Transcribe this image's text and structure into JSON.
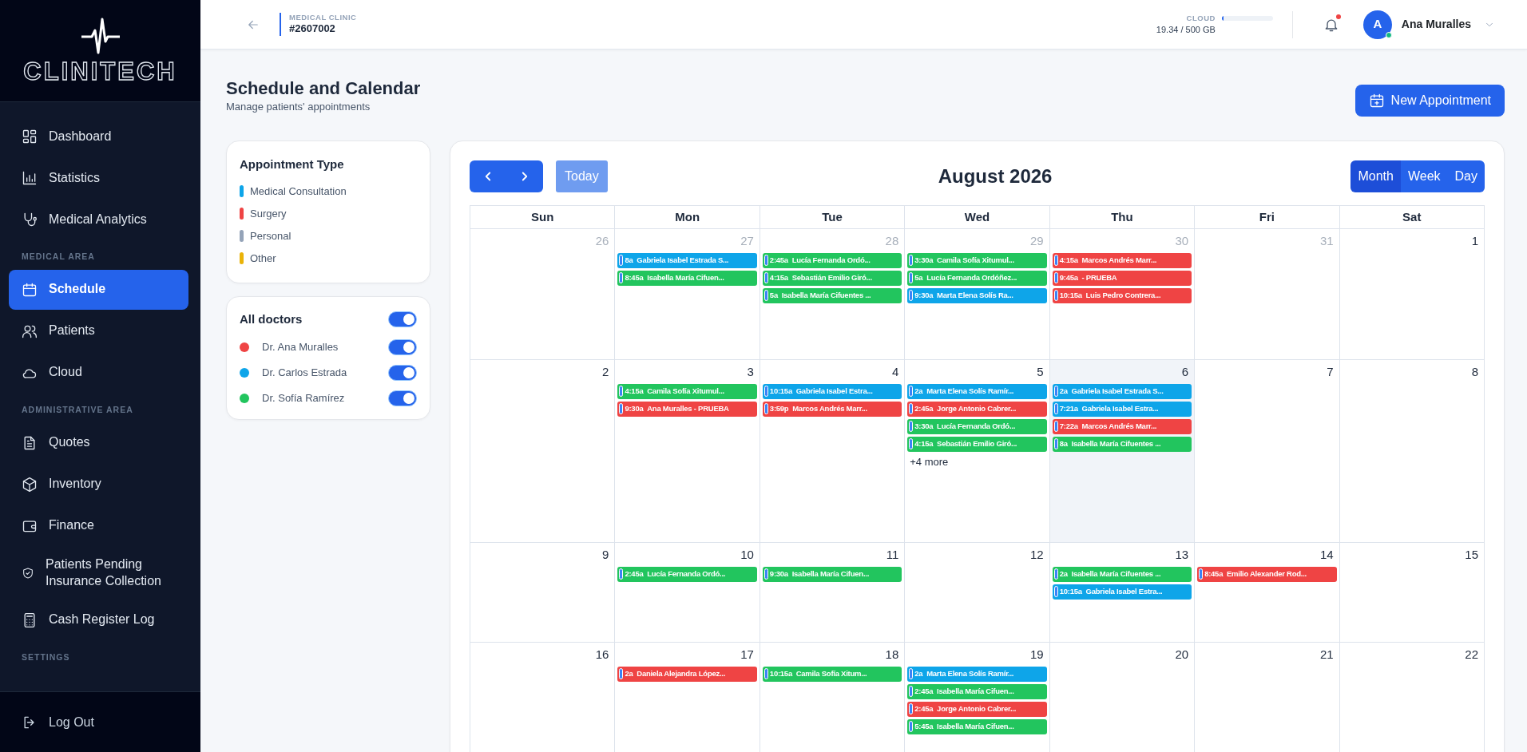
{
  "sidebar": {
    "logo": "CLINITECH",
    "items": [
      {
        "kind": "link",
        "label": "Dashboard",
        "selected": false
      },
      {
        "kind": "link",
        "label": "Statistics",
        "selected": false
      },
      {
        "kind": "link",
        "label": "Medical Analytics",
        "selected": false
      },
      {
        "kind": "section",
        "label": "MEDICAL AREA"
      },
      {
        "kind": "link",
        "label": "Schedule",
        "selected": true
      },
      {
        "kind": "link",
        "label": "Patients",
        "selected": false
      },
      {
        "kind": "link",
        "label": "Cloud",
        "selected": false
      },
      {
        "kind": "section",
        "label": "ADMINISTRATIVE AREA"
      },
      {
        "kind": "link",
        "label": "Quotes",
        "selected": false
      },
      {
        "kind": "link",
        "label": "Inventory",
        "selected": false
      },
      {
        "kind": "link",
        "label": "Finance",
        "selected": false
      },
      {
        "kind": "link",
        "label": "Patients Pending Insurance Collection",
        "selected": false
      },
      {
        "kind": "link",
        "label": "Cash Register Log",
        "selected": false
      },
      {
        "kind": "section",
        "label": "SETTINGS"
      }
    ],
    "logout": "Log Out"
  },
  "topbar": {
    "clinic_label": "MEDICAL CLINIC",
    "clinic_id": "#2607002",
    "cloud": {
      "label": "CLOUD",
      "usage": "19.34 / 500 GB",
      "level": 0.04
    },
    "notification_unread": true,
    "avatar_letter": "A",
    "user_online": true,
    "user_name": "Ana Muralles"
  },
  "page": {
    "title": "Schedule and Calendar",
    "subtitle": "Manage patients' appointments",
    "new_button": "New Appointment"
  },
  "appointment_types": {
    "title": "Appointment Type",
    "items": [
      {
        "label": "Medical Consultation",
        "color": "#0ea5e9"
      },
      {
        "label": "Surgery",
        "color": "#ef4444"
      },
      {
        "label": "Personal",
        "color": "#94a3b8"
      },
      {
        "label": "Other",
        "color": "#eab308"
      }
    ]
  },
  "doctors": {
    "title": "All doctors",
    "all_on": true,
    "items": [
      {
        "name": "Dr. Ana Muralles",
        "color": "#ef4444",
        "on": true
      },
      {
        "name": "Dr. Carlos Estrada",
        "color": "#0ea5e9",
        "on": true
      },
      {
        "name": "Dr. Sofía Ramírez",
        "color": "#22c55e",
        "on": true
      }
    ]
  },
  "calendar": {
    "title": "August 2026",
    "today_button": "Today",
    "views": [
      {
        "label": "Month",
        "selected": true
      },
      {
        "label": "Week",
        "selected": false
      },
      {
        "label": "Day",
        "selected": false
      }
    ],
    "weekdays": [
      "Sun",
      "Mon",
      "Tue",
      "Wed",
      "Thu",
      "Fri",
      "Sat"
    ],
    "weeks": [
      [
        {
          "day": "26",
          "muted": true
        },
        {
          "day": "27",
          "muted": true,
          "events": [
            {
              "time": "8a",
              "title": "Gabriela Isabel Estrada S...",
              "color": "#0ea5e9"
            },
            {
              "time": "8:45a",
              "title": "Isabella María Cifuen...",
              "color": "#22c55e"
            }
          ]
        },
        {
          "day": "28",
          "muted": true,
          "events": [
            {
              "time": "2:45a",
              "title": "Lucía Fernanda Ordó...",
              "color": "#22c55e"
            },
            {
              "time": "4:15a",
              "title": "Sebastián Emilio Giró...",
              "color": "#22c55e"
            },
            {
              "time": "5a",
              "title": "Isabella María Cifuentes ...",
              "color": "#22c55e"
            }
          ]
        },
        {
          "day": "29",
          "muted": true,
          "events": [
            {
              "time": "3:30a",
              "title": "Camila Sofía Xitumul...",
              "color": "#22c55e"
            },
            {
              "time": "5a",
              "title": "Lucía Fernanda Ordóñez...",
              "color": "#22c55e"
            },
            {
              "time": "9:30a",
              "title": "Marta Elena Solís Ra...",
              "color": "#0ea5e9"
            }
          ]
        },
        {
          "day": "30",
          "muted": true,
          "events": [
            {
              "time": "4:15a",
              "title": "Marcos Andrés Marr...",
              "color": "#ef4444"
            },
            {
              "time": "9:45a",
              "title": "- PRUEBA",
              "color": "#ef4444"
            },
            {
              "time": "10:15a",
              "title": "Luis Pedro Contrera...",
              "color": "#ef4444"
            }
          ]
        },
        {
          "day": "31",
          "muted": true
        },
        {
          "day": "1"
        }
      ],
      [
        {
          "day": "2"
        },
        {
          "day": "3",
          "events": [
            {
              "time": "4:15a",
              "title": "Camila Sofía Xitumul...",
              "color": "#22c55e"
            },
            {
              "time": "9:30a",
              "title": "Ana Muralles - PRUEBA",
              "color": "#ef4444"
            }
          ]
        },
        {
          "day": "4",
          "events": [
            {
              "time": "10:15a",
              "title": "Gabriela Isabel Estra...",
              "color": "#0ea5e9"
            },
            {
              "time": "3:59p",
              "title": "Marcos Andrés Marr...",
              "color": "#ef4444"
            }
          ]
        },
        {
          "day": "5",
          "events": [
            {
              "time": "2a",
              "title": "Marta Elena Solís Ramír...",
              "color": "#0ea5e9"
            },
            {
              "time": "2:45a",
              "title": "Jorge Antonio Cabrer...",
              "color": "#ef4444"
            },
            {
              "time": "3:30a",
              "title": "Lucía Fernanda Ordó...",
              "color": "#22c55e"
            },
            {
              "time": "4:15a",
              "title": "Sebastián Emilio Giró...",
              "color": "#22c55e"
            }
          ],
          "more": "+4 more"
        },
        {
          "day": "6",
          "today": true,
          "events": [
            {
              "time": "2a",
              "title": "Gabriela Isabel Estrada S...",
              "color": "#0ea5e9"
            },
            {
              "time": "7:21a",
              "title": "Gabriela Isabel Estra...",
              "color": "#0ea5e9"
            },
            {
              "time": "7:22a",
              "title": "Marcos Andrés Marr...",
              "color": "#ef4444"
            },
            {
              "time": "8a",
              "title": "Isabella María Cifuentes ...",
              "color": "#22c55e"
            }
          ]
        },
        {
          "day": "7"
        },
        {
          "day": "8"
        }
      ],
      [
        {
          "day": "9"
        },
        {
          "day": "10",
          "events": [
            {
              "time": "2:45a",
              "title": "Lucía Fernanda Ordó...",
              "color": "#22c55e"
            }
          ]
        },
        {
          "day": "11",
          "events": [
            {
              "time": "9:30a",
              "title": "Isabella María Cifuen...",
              "color": "#22c55e"
            }
          ]
        },
        {
          "day": "12"
        },
        {
          "day": "13",
          "events": [
            {
              "time": "2a",
              "title": "Isabella María Cifuentes ...",
              "color": "#22c55e"
            },
            {
              "time": "10:15a",
              "title": "Gabriela Isabel Estra...",
              "color": "#0ea5e9"
            }
          ]
        },
        {
          "day": "14",
          "events": [
            {
              "time": "8:45a",
              "title": "Emilio Alexander Rod...",
              "color": "#ef4444"
            }
          ]
        },
        {
          "day": "15"
        }
      ],
      [
        {
          "day": "16"
        },
        {
          "day": "17",
          "events": [
            {
              "time": "2a",
              "title": "Daniela Alejandra López...",
              "color": "#ef4444"
            }
          ]
        },
        {
          "day": "18",
          "events": [
            {
              "time": "10:15a",
              "title": "Camila Sofía Xitum...",
              "color": "#22c55e"
            }
          ]
        },
        {
          "day": "19",
          "events": [
            {
              "time": "2a",
              "title": "Marta Elena Solís Ramír...",
              "color": "#0ea5e9"
            },
            {
              "time": "2:45a",
              "title": "Isabella María Cifuen...",
              "color": "#22c55e"
            },
            {
              "time": "2:45a",
              "title": "Jorge Antonio Cabrer...",
              "color": "#ef4444"
            },
            {
              "time": "5:45a",
              "title": "Isabella María Cifuen...",
              "color": "#22c55e"
            }
          ]
        },
        {
          "day": "20"
        },
        {
          "day": "21"
        },
        {
          "day": "22"
        }
      ]
    ]
  }
}
